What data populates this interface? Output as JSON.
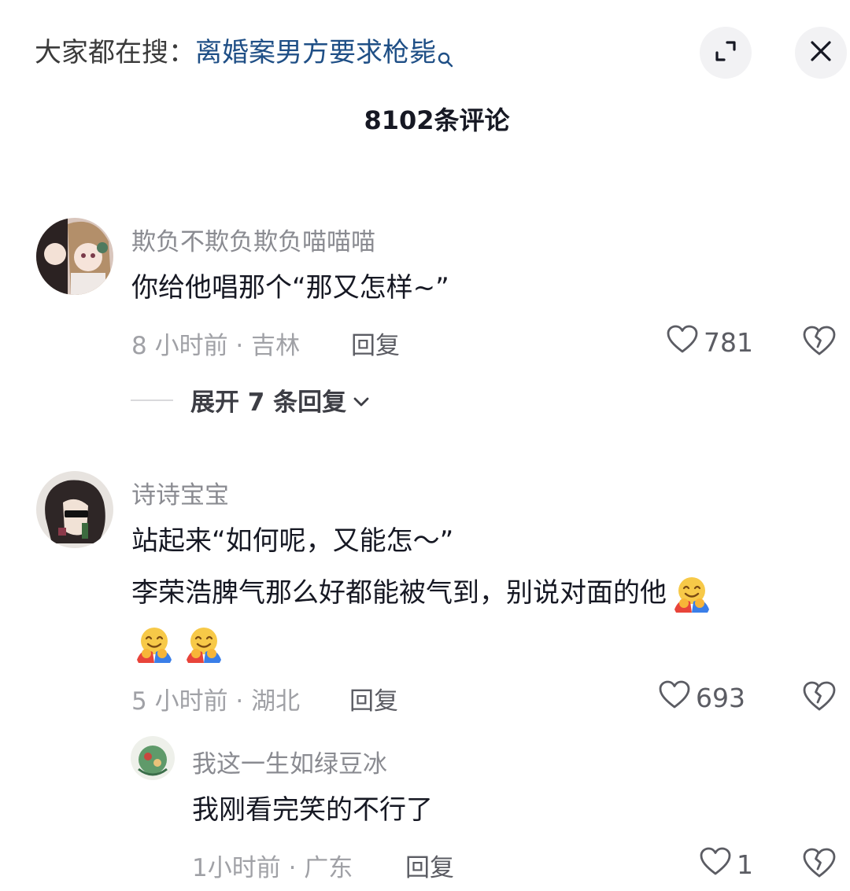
{
  "search": {
    "prefix": "大家都在搜：",
    "query": "离婚案男方要求枪毙"
  },
  "icons": {
    "search": "search-icon",
    "expand": "expand-icon",
    "close": "close-icon",
    "like": "heart-icon",
    "dislike": "broken-heart-icon",
    "chevron": "chevron-down-icon",
    "hug": "hugging-face-emoji"
  },
  "comment_count": "8102条评论",
  "comments": [
    {
      "user": "欺负不欺负欺负喵喵喵",
      "lines": [
        "你给他唱那个“那又怎样~”"
      ],
      "time_location": "8 小时前 · 吉林",
      "reply_label": "回复",
      "likes": "781",
      "expand_label": "展开 7 条回复"
    },
    {
      "user": "诗诗宝宝",
      "lines": [
        "站起来“如何呢，又能怎～”",
        "李荣浩脾气那么好都能被气到，别说对面的他"
      ],
      "time_location": "5 小时前 · 湖北",
      "reply_label": "回复",
      "likes": "693",
      "replies": [
        {
          "user": "我这一生如绿豆冰",
          "text": "我刚看完笑的不行了",
          "time_location": "1小时前 · 广东",
          "reply_label": "回复",
          "likes": "1"
        }
      ]
    }
  ],
  "colors": {
    "query": "#1f4f86",
    "text": "#161823",
    "muted": "#8a8b91",
    "button_bg": "#f2f2f4"
  }
}
